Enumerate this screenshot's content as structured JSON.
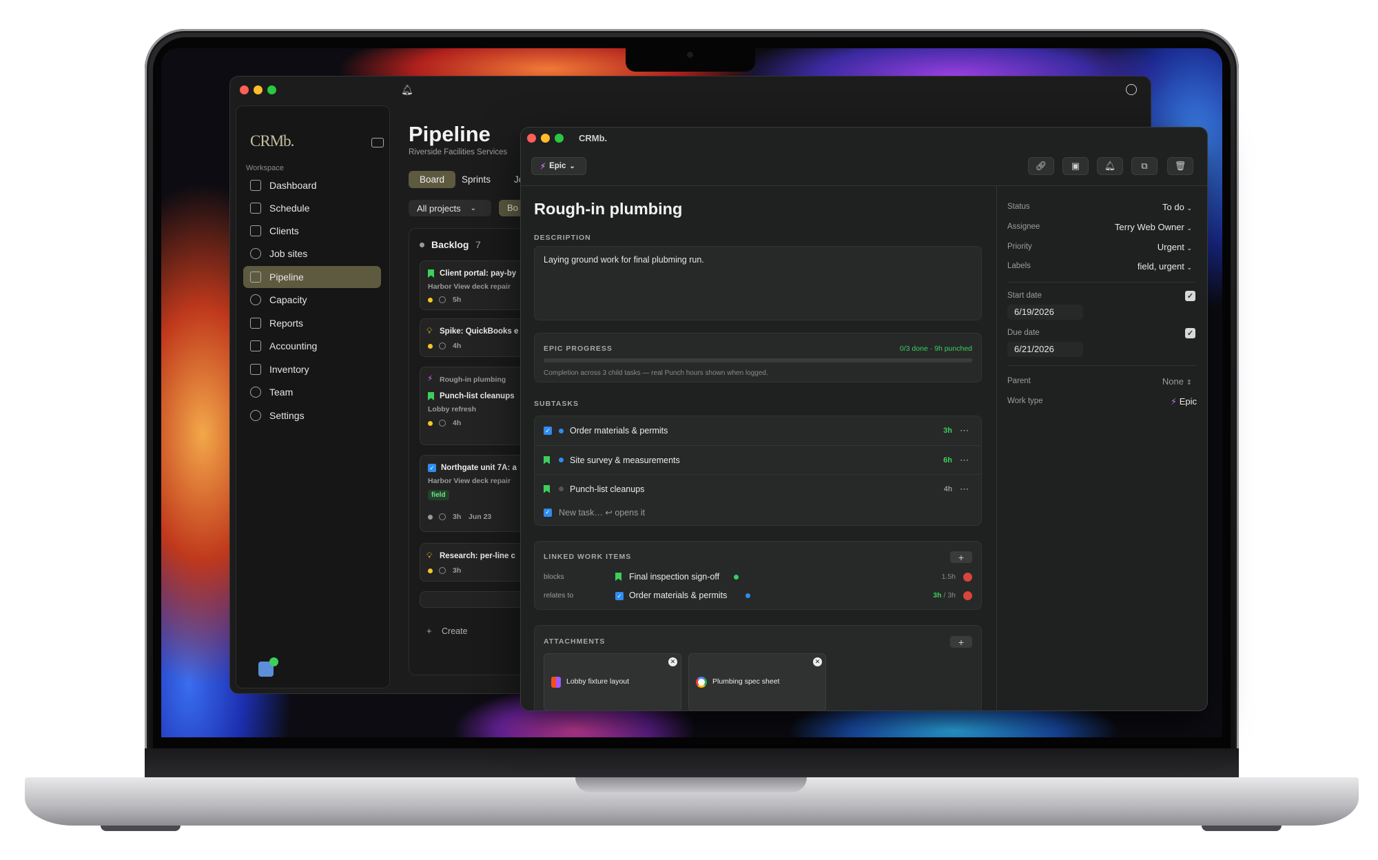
{
  "background_app": {
    "brand": "CRMb.",
    "workspace_label": "Workspace",
    "nav": [
      {
        "label": "Dashboard",
        "icon": "grid-icon"
      },
      {
        "label": "Schedule",
        "icon": "calendar-icon"
      },
      {
        "label": "Clients",
        "icon": "contact-icon"
      },
      {
        "label": "Job sites",
        "icon": "pin-icon"
      },
      {
        "label": "Pipeline",
        "icon": "briefcase-icon",
        "active": true
      },
      {
        "label": "Capacity",
        "icon": "gauge-icon"
      },
      {
        "label": "Reports",
        "icon": "report-icon"
      },
      {
        "label": "Accounting",
        "icon": "bank-icon"
      },
      {
        "label": "Inventory",
        "icon": "box-icon"
      },
      {
        "label": "Team",
        "icon": "people-icon"
      },
      {
        "label": "Settings",
        "icon": "gear-icon"
      }
    ],
    "page_title": "Pipeline",
    "page_subtitle": "Riverside Facilities Services",
    "tabs": [
      "Board",
      "Sprints",
      "Jo"
    ],
    "filter_projects": "All projects",
    "filter_b": "Bo",
    "column": {
      "name": "Backlog",
      "count": "7",
      "cards": [
        {
          "title": "Client portal: pay-by",
          "sub": "Harbor View deck repair",
          "estimate": "5h"
        },
        {
          "title": "Spike: QuickBooks e",
          "estimate": "4h"
        },
        {
          "parent": "Rough-in plumbing",
          "title": "Punch-list cleanups",
          "sub": "Lobby refresh",
          "estimate": "4h"
        },
        {
          "title": "Northgate unit 7A: a",
          "sub": "Harbor View deck repair",
          "tag": "field",
          "estimate": "3h",
          "date": "Jun 23"
        },
        {
          "title": "Research: per-line c",
          "estimate": "3h"
        }
      ],
      "create_label": "Create"
    }
  },
  "detail": {
    "window_title": "CRMb.",
    "type_badge": "Epic",
    "title": "Rough-in plumbing",
    "description_label": "DESCRIPTION",
    "description": "Laying ground work for final plubming run.",
    "progress": {
      "label": "EPIC PROGRESS",
      "summary": "0/3 done · 9h punched",
      "fraction": 0,
      "note": "Completion across 3 child tasks — real Punch hours shown when logged."
    },
    "subtasks_label": "SUBTASKS",
    "subtasks": [
      {
        "title": "Order materials & permits",
        "hours": "3h",
        "kind": "task"
      },
      {
        "title": "Site survey & measurements",
        "hours": "6h",
        "kind": "story"
      },
      {
        "title": "Punch-list cleanups",
        "hours": "4h",
        "kind": "story"
      }
    ],
    "new_task_placeholder": "New task… ↩ opens it",
    "linked_label": "LINKED WORK ITEMS",
    "linked": [
      {
        "relation": "blocks",
        "title": "Final inspection sign-off",
        "hours": "1.5h"
      },
      {
        "relation": "relates to",
        "title": "Order materials & permits",
        "hours_done": "3h",
        "hours_total": " / 3h"
      }
    ],
    "attachments_label": "ATTACHMENTS",
    "attachments": [
      {
        "name": "Lobby fixture layout",
        "icon": "figma-icon"
      },
      {
        "name": "Plumbing spec sheet",
        "icon": "google-icon"
      }
    ],
    "props": {
      "status_k": "Status",
      "status_v": "To do",
      "assignee_k": "Assignee",
      "assignee_v": "Terry Web Owner",
      "priority_k": "Priority",
      "priority_v": "Urgent",
      "labels_k": "Labels",
      "labels_v": "field, urgent",
      "start_k": "Start date",
      "start_v": "6/19/2026",
      "due_k": "Due date",
      "due_v": "6/21/2026",
      "parent_k": "Parent",
      "parent_v": "None",
      "worktype_k": "Work type",
      "worktype_v": "Epic"
    }
  },
  "colors": {
    "accent_green": "#3ccf5c",
    "active_nav": "#5d5a40",
    "task_blue": "#2f8cf0",
    "danger": "#d9453b"
  }
}
